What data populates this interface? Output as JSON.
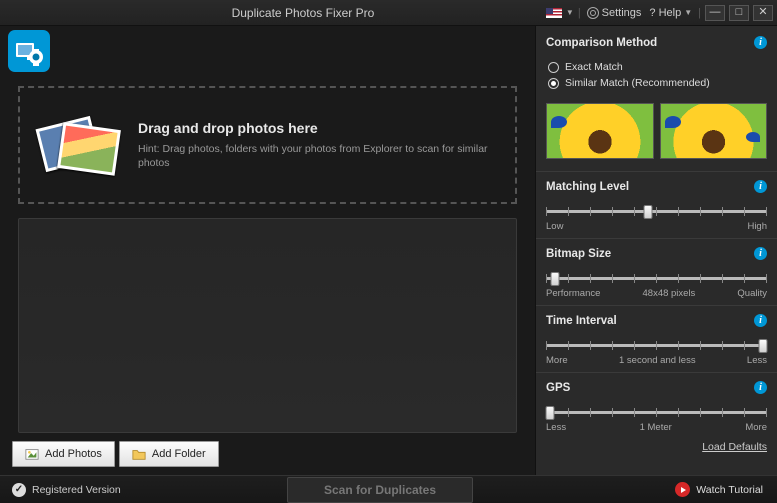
{
  "title": "Duplicate Photos Fixer Pro",
  "titlebar": {
    "settings_label": "Settings",
    "help_label": "? Help"
  },
  "dropzone": {
    "heading": "Drag and drop photos here",
    "hint": "Hint: Drag photos, folders with your photos from Explorer to scan for similar photos"
  },
  "buttons": {
    "add_photos": "Add Photos",
    "add_folder": "Add Folder"
  },
  "panel": {
    "comparison_method": "Comparison Method",
    "exact_match": "Exact Match",
    "similar_match": "Similar Match (Recommended)",
    "selected_method": "similar",
    "matching_level": {
      "title": "Matching Level",
      "low": "Low",
      "high": "High",
      "position": 46
    },
    "bitmap_size": {
      "title": "Bitmap Size",
      "left": "Performance",
      "right": "Quality",
      "mid": "48x48 pixels",
      "position": 4
    },
    "time_interval": {
      "title": "Time Interval",
      "left": "More",
      "right": "Less",
      "mid": "1 second and less",
      "position": 98
    },
    "gps": {
      "title": "GPS",
      "left": "Less",
      "right": "More",
      "mid": "1 Meter",
      "position": 2
    },
    "load_defaults": "Load Defaults"
  },
  "footer": {
    "registered": "Registered Version",
    "scan": "Scan for Duplicates",
    "watch": "Watch Tutorial"
  }
}
